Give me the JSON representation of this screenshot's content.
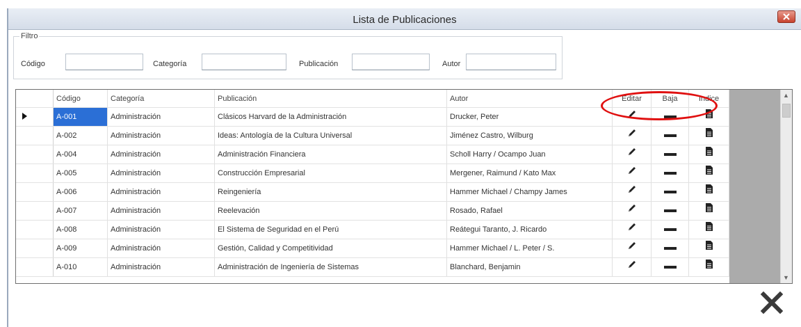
{
  "window": {
    "title": "Lista de Publicaciones"
  },
  "filter": {
    "legend": "Filtro",
    "codigo_label": "Código",
    "categoria_label": "Categoría",
    "publicacion_label": "Publicación",
    "autor_label": "Autor",
    "codigo_value": "",
    "categoria_value": "",
    "publicacion_value": "",
    "autor_value": ""
  },
  "grid": {
    "columns": [
      "Código",
      "Categoría",
      "Publicación",
      "Autor",
      "Editar",
      "Baja",
      "Indice"
    ],
    "rows": [
      {
        "codigo": "A-001",
        "categoria": "Administración",
        "publicacion": "Clásicos Harvard de la Administración",
        "autor": "Drucker, Peter"
      },
      {
        "codigo": "A-002",
        "categoria": "Administración",
        "publicacion": "Ideas: Antología de la Cultura Universal",
        "autor": "Jiménez Castro, Wilburg"
      },
      {
        "codigo": "A-004",
        "categoria": "Administración",
        "publicacion": "Administración Financiera",
        "autor": "Scholl Harry / Ocampo Juan"
      },
      {
        "codigo": "A-005",
        "categoria": "Administración",
        "publicacion": "Construcción Empresarial",
        "autor": "Mergener, Raimund / Kato Max"
      },
      {
        "codigo": "A-006",
        "categoria": "Administración",
        "publicacion": "Reingeniería",
        "autor": "Hammer Michael / Champy James"
      },
      {
        "codigo": "A-007",
        "categoria": "Administración",
        "publicacion": "Reelevación",
        "autor": "Rosado, Rafael"
      },
      {
        "codigo": "A-008",
        "categoria": "Administración",
        "publicacion": "El Sistema de Seguridad en el Perú",
        "autor": "Reátegui Taranto, J. Ricardo"
      },
      {
        "codigo": "A-009",
        "categoria": "Administración",
        "publicacion": "Gestión, Calidad y Competitividad",
        "autor": "Hammer Michael / L. Peter / S."
      },
      {
        "codigo": "A-010",
        "categoria": "Administración",
        "publicacion": "Administración de Ingeniería de Sistemas",
        "autor": "Blanchard, Benjamin"
      }
    ]
  },
  "icons": {
    "edit": "pencil-icon",
    "delete": "minus-bar-icon",
    "index": "document-icon",
    "row_pointer": "triangle-right-icon",
    "close": "x-icon"
  },
  "colors": {
    "selection": "#2b6fd6",
    "highlight": "#e01010",
    "close_button": "#c8432e"
  }
}
